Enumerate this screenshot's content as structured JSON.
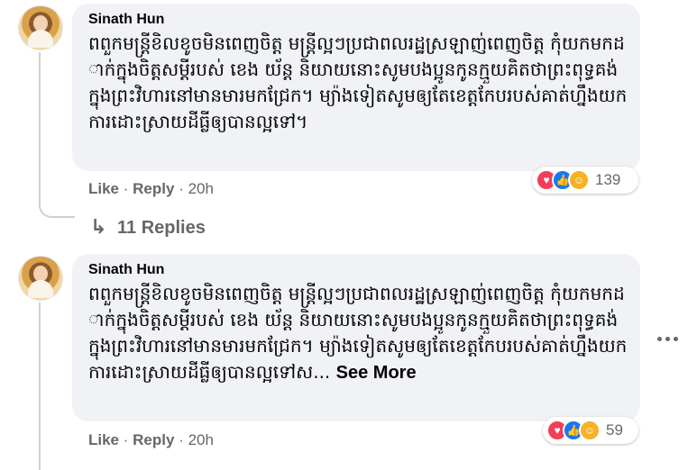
{
  "comments": [
    {
      "author": "Sinath Hun",
      "text": "ពពួកមន្រ្តីខិលខូចមិនពេញចិត្ត មន្រ្តីល្អៗប្រជាពលរដ្ឋស្រឡាញ់ពេញចិត្ត កុំយកមកដាក់ក្នុងចិត្តសម្តីរបស់ ខេង យ័ន្ត និយាយនោះសូមបងប្អូនកូនក្មួយគិតថាព្រះពុទ្ធគង់ក្នុងព្រះវិហារនៅមានមារមកជ្រែក។ ម្យ៉ាងទៀតសូមឲ្យតែខេត្តកែបរបស់គាត់ហ្នឹងយកការដោះស្រាយដីធ្លីឲ្យបានល្អទៅ។",
      "see_more": "",
      "like": "Like",
      "reply": "Reply",
      "time": "20h",
      "reaction_count": "139"
    },
    {
      "author": "Sinath Hun",
      "text": "ពពួកមន្រ្តីខិលខូចមិនពេញចិត្ត មន្រ្តីល្អៗប្រជាពលរដ្ឋស្រឡាញ់ពេញចិត្ត កុំយកមកដាក់ក្នុងចិត្តសម្តីរបស់ ខេង យ័ន្ត និយាយនោះសូមបងប្អូនកូនក្មួយគិតថាព្រះពុទ្ធគង់ក្នុងព្រះវិហារនៅមានមារមកជ្រែក។ ម្យ៉ាងទៀតសូមឲ្យតែខេត្តកែបរបស់គាត់ហ្នឹងយកការដោះស្រាយដីធ្លីឲ្យបានល្អទៅស...",
      "see_more": "See More",
      "like": "Like",
      "reply": "Reply",
      "time": "20h",
      "reaction_count": "59"
    }
  ],
  "replies_link": {
    "arrow": "↳",
    "label": "11 Replies"
  },
  "reaction_icons": [
    "love-icon",
    "like-icon",
    "care-icon"
  ],
  "colors": {
    "bubble": "#f0f2f5",
    "secondary_text": "#65676b",
    "like_blue": "#1877f2",
    "love_red": "#f33e58",
    "care_yellow": "#f7b125"
  }
}
